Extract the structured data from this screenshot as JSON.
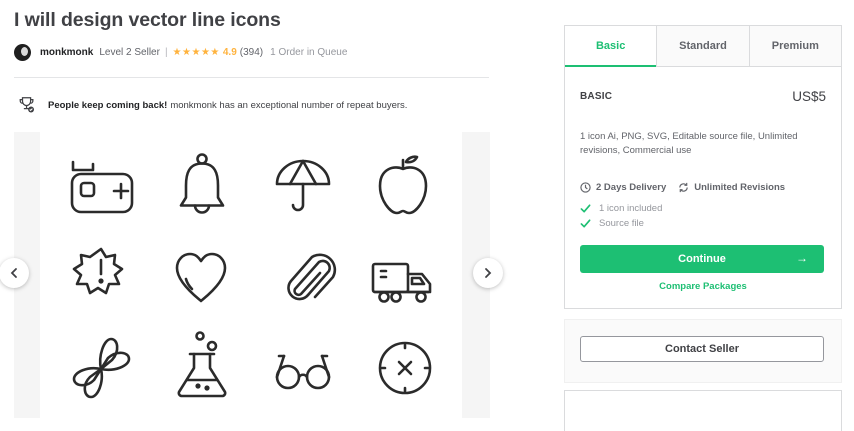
{
  "gig": {
    "title": "I will design vector line icons"
  },
  "seller": {
    "name": "monkmonk",
    "level": "Level 2 Seller",
    "separator": "|",
    "stars": "★★★★★",
    "rating": "4.9",
    "reviews": "(394)",
    "queue": "1 Order in Queue"
  },
  "repeat_notice": {
    "bold": "People keep coming back!",
    "text": "monkmonk has an exceptional number of repeat buyers."
  },
  "gallery": {
    "icons": [
      "gamepad-icon",
      "bell-icon",
      "umbrella-icon",
      "apple-icon",
      "warning-badge-icon",
      "heart-icon",
      "paperclip-icon",
      "truck-icon",
      "propeller-icon",
      "flask-icon",
      "glasses-icon",
      "clock-icon"
    ]
  },
  "packages": {
    "tabs": [
      "Basic",
      "Standard",
      "Premium"
    ],
    "active_tab": "Basic",
    "name": "BASIC",
    "price": "US$5",
    "description": "1 icon Ai, PNG, SVG, Editable source file, Unlimited revisions, Commercial use",
    "delivery": "2 Days Delivery",
    "revisions": "Unlimited Revisions",
    "features": [
      "1 icon included",
      "Source file"
    ],
    "continue_label": "Continue",
    "continue_arrow": "→",
    "compare_label": "Compare Packages"
  },
  "contact": {
    "label": "Contact Seller"
  },
  "colors": {
    "accent": "#1dbf73",
    "star": "#ffb33e",
    "text": "#404145"
  }
}
